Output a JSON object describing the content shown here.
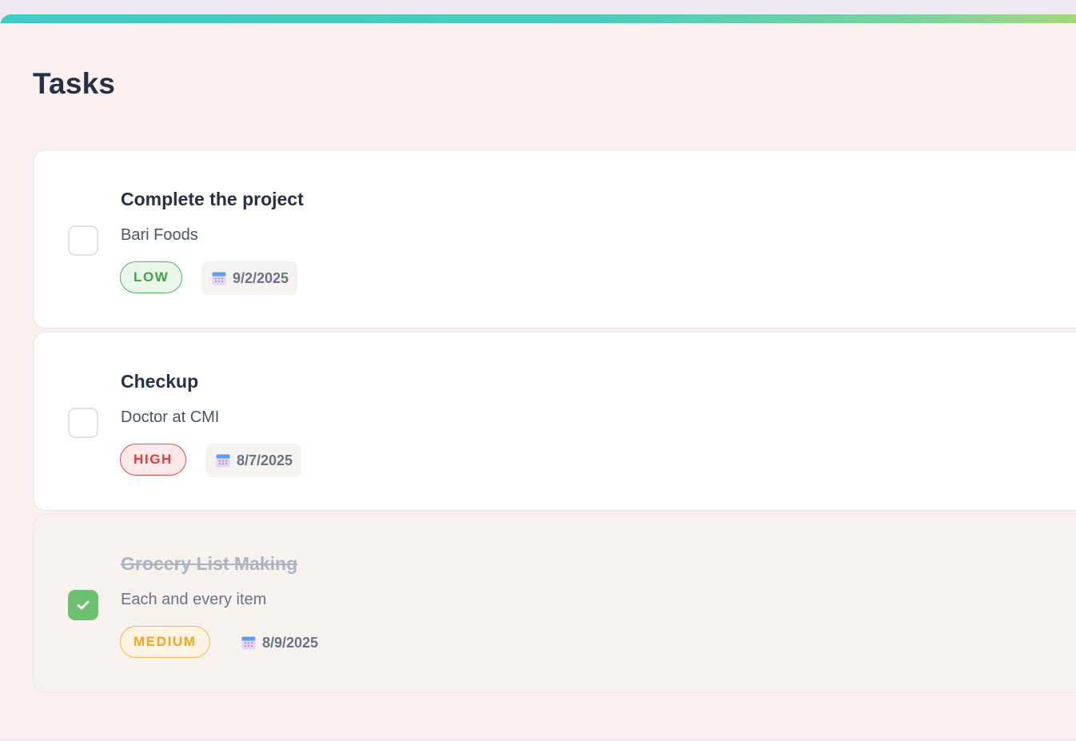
{
  "page": {
    "title": "Tasks"
  },
  "tasks": [
    {
      "title": "Complete the project",
      "description": "Bari Foods",
      "priority": "LOW",
      "date": "9/2/2025",
      "completed": false
    },
    {
      "title": "Checkup",
      "description": "Doctor at CMI",
      "priority": "HIGH",
      "date": "8/7/2025",
      "completed": false
    },
    {
      "title": "Grocery List Making",
      "description": "Each and every item",
      "priority": "MEDIUM",
      "date": "8/9/2025",
      "completed": true
    }
  ],
  "icons": {
    "date": "calendar-icon",
    "done": "checkmark-icon"
  },
  "colors": {
    "accent": "#40cbc4",
    "low": "#43a047",
    "high": "#e53a40",
    "medium": "#f7a51f",
    "checked": "#6cc070"
  }
}
